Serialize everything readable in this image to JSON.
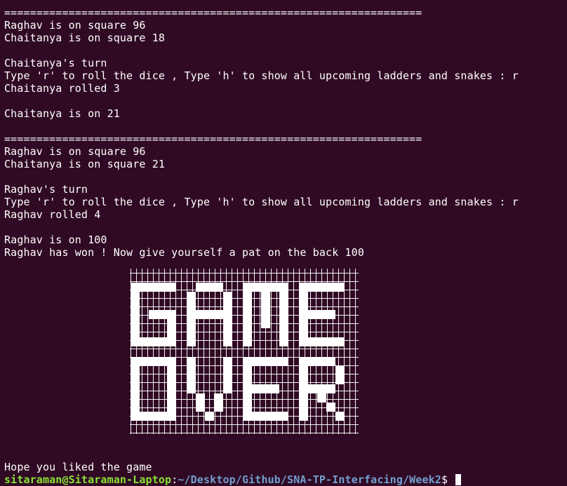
{
  "terminal": {
    "theme": {
      "background": "#300a24",
      "foreground": "#ffffff",
      "prompt_user_color": "#8ae234",
      "prompt_path_color": "#729fcf"
    },
    "lines": [
      "=================================================================",
      "Raghav is on square 96",
      "Chaitanya is on square 18",
      "",
      "Chaitanya's turn",
      "Type 'r' to roll the dice , Type 'h' to show all upcoming ladders and snakes : r",
      "Chaitanya rolled 3",
      "",
      "Chaitanya is on 21",
      "",
      "=================================================================",
      "Raghav is on square 96",
      "Chaitanya is on square 21",
      "",
      "Raghav's turn",
      "Type 'r' to roll the dice , Type 'h' to show all upcoming ladders and snakes : r",
      "Raghav rolled 4",
      "",
      "Raghav is on 100",
      "Raghav has won ! Now give yourself a pat on the back 100"
    ],
    "banner": {
      "row1": "GAME",
      "row2": "OVER",
      "icon": "game-over-ascii-art"
    },
    "closing_line": "Hope you liked the game",
    "prompt": {
      "user_host": "sitaraman@Sitaraman-Laptop",
      "separator": ":",
      "path": "~/Desktop/Github/SNA-TP-Interfacing/Week2",
      "symbol": "$ "
    }
  }
}
